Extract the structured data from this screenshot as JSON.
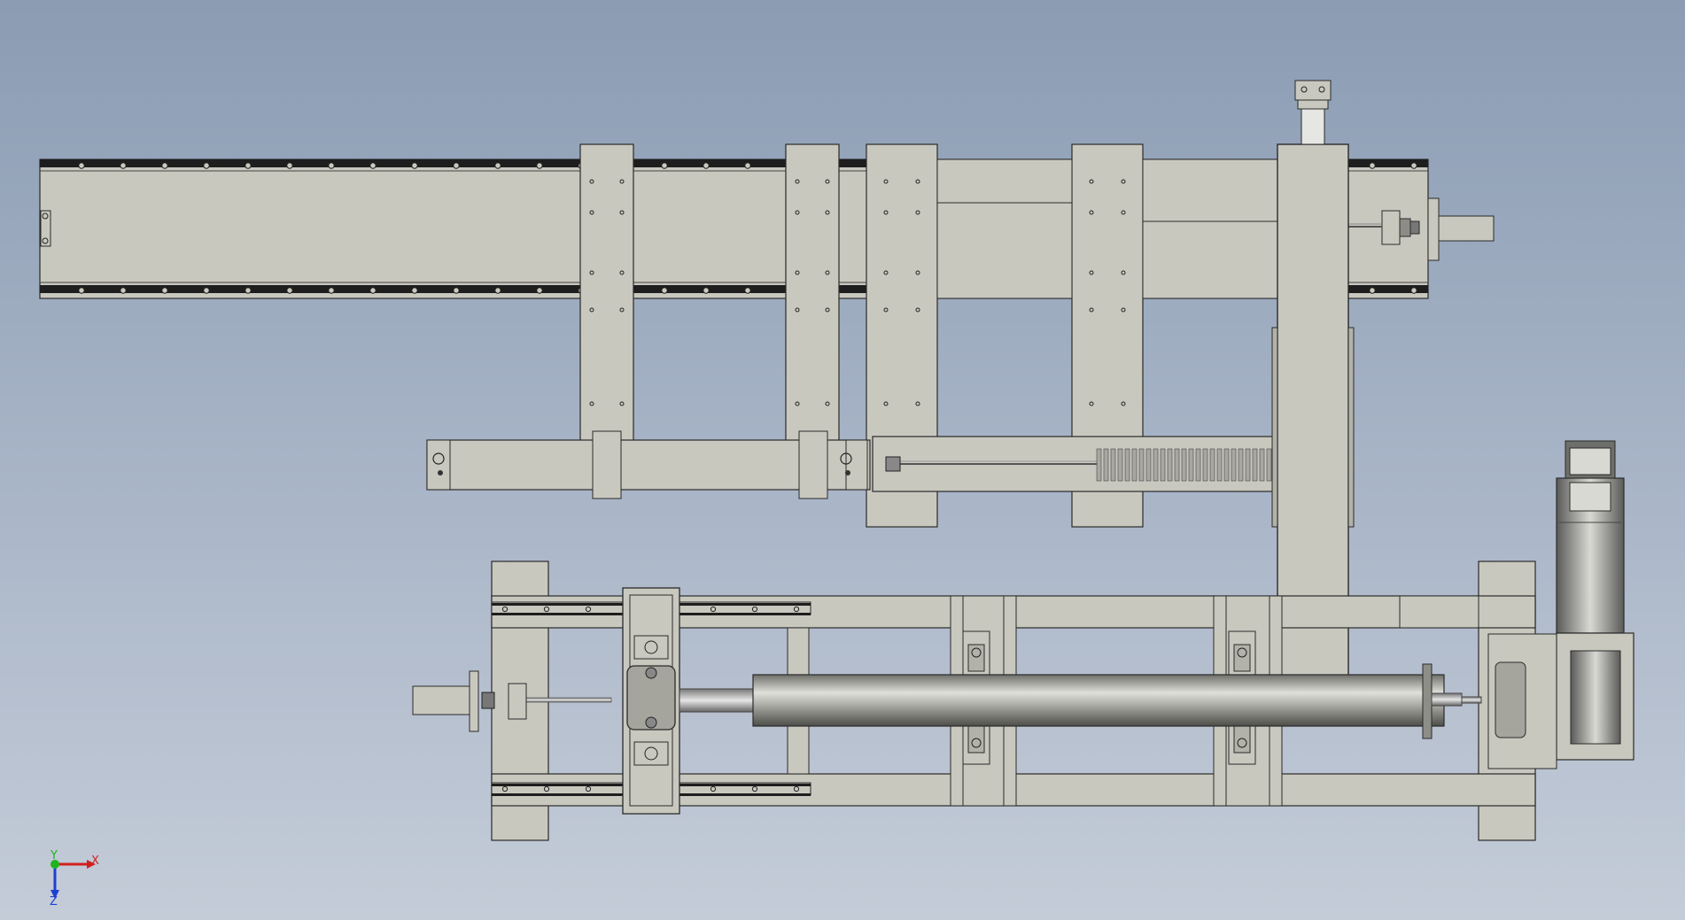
{
  "scene": {
    "background_top": "#8b9cb3",
    "background_bottom": "#c4ccd8",
    "part_fill": "#c9c8bf",
    "part_fill_dark": "#b3b2a9",
    "rail_color": "#1e1e1e",
    "edge_color": "#2a2a2a"
  },
  "triad": {
    "x_label": "X",
    "y_label": "Y",
    "z_label": "Z",
    "x_color": "#d21f1f",
    "y_color": "#1fb31f",
    "z_color": "#1f3fd2",
    "origin_icon": "axis-triad-icon"
  }
}
